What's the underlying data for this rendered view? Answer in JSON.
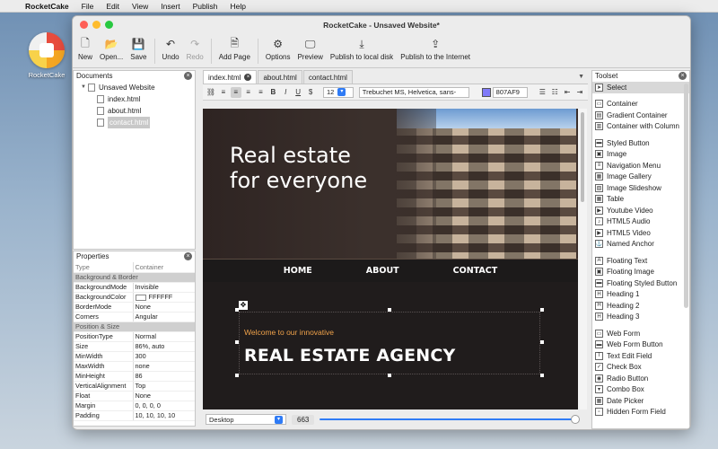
{
  "menubar": {
    "app_name": "RocketCake",
    "items": [
      "File",
      "Edit",
      "View",
      "Insert",
      "Publish",
      "Help"
    ]
  },
  "desktop": {
    "icon_label": "RocketCake"
  },
  "window": {
    "title": "RocketCake - Unsaved Website*"
  },
  "toolbar": {
    "new": "New",
    "open": "Open...",
    "save": "Save",
    "undo": "Undo",
    "redo": "Redo",
    "add_page": "Add Page",
    "options": "Options",
    "preview": "Preview",
    "publish_local": "Publish to local disk",
    "publish_internet": "Publish to the Internet"
  },
  "documents": {
    "title": "Documents",
    "root": "Unsaved Website",
    "pages": [
      "index.html",
      "about.html",
      "contact.html"
    ],
    "selected_page": "contact.html"
  },
  "properties": {
    "title": "Properties",
    "header": {
      "name": "Type",
      "value": "Container"
    },
    "rows": [
      {
        "section": "Background & Border"
      },
      {
        "name": "BackgroundMode",
        "value": "Invisible"
      },
      {
        "name": "BackgroundColor",
        "value": "FFFFFF",
        "swatch": true
      },
      {
        "name": "BorderMode",
        "value": "None"
      },
      {
        "name": "Corners",
        "value": "Angular"
      },
      {
        "section": "Position & Size"
      },
      {
        "name": "PositionType",
        "value": "Normal"
      },
      {
        "name": "Size",
        "value": "86%, auto"
      },
      {
        "name": "MinWidth",
        "value": "300"
      },
      {
        "name": "MaxWidth",
        "value": "none"
      },
      {
        "name": "MinHeight",
        "value": "86"
      },
      {
        "name": "VerticalAlignment",
        "value": "Top"
      },
      {
        "name": "Float",
        "value": "None"
      },
      {
        "name": "Margin",
        "value": "0, 0, 0, 0"
      },
      {
        "name": "Padding",
        "value": "10, 10, 10, 10"
      }
    ]
  },
  "editor": {
    "tabs": [
      "index.html",
      "about.html",
      "contact.html"
    ],
    "active_tab": "index.html",
    "font_size": "12",
    "font_family": "Trebuchet MS, Helvetica, sans-",
    "color_hex": "807AF9",
    "color": "#807af9"
  },
  "page": {
    "hero_line1": "Real estate",
    "hero_line2": "for everyone",
    "nav": [
      "HOME",
      "ABOUT",
      "CONTACT"
    ],
    "welcome": "Welcome to our innovative",
    "agency": "REAL ESTATE  AGENCY"
  },
  "bottom": {
    "device": "Desktop",
    "width": "663"
  },
  "toolset": {
    "title": "Toolset",
    "groups": [
      [
        {
          "label": "Select",
          "icon": "cursor-icon",
          "selected": true
        }
      ],
      [
        {
          "label": "Container",
          "icon": "container-icon"
        },
        {
          "label": "Gradient Container",
          "icon": "gradient-container-icon"
        },
        {
          "label": "Container with Column",
          "icon": "columns-icon"
        }
      ],
      [
        {
          "label": "Styled Button",
          "icon": "button-icon"
        },
        {
          "label": "Image",
          "icon": "image-icon"
        },
        {
          "label": "Navigation Menu",
          "icon": "menu-icon"
        },
        {
          "label": "Image Gallery",
          "icon": "gallery-icon"
        },
        {
          "label": "Image Slideshow",
          "icon": "slideshow-icon"
        },
        {
          "label": "Table",
          "icon": "table-icon"
        },
        {
          "label": "Youtube Video",
          "icon": "youtube-icon"
        },
        {
          "label": "HTML5 Audio",
          "icon": "audio-icon"
        },
        {
          "label": "HTML5 Video",
          "icon": "video-icon"
        },
        {
          "label": "Named Anchor",
          "icon": "anchor-icon"
        }
      ],
      [
        {
          "label": "Floating Text",
          "icon": "text-icon"
        },
        {
          "label": "Floating Image",
          "icon": "float-image-icon"
        },
        {
          "label": "Floating Styled Button",
          "icon": "float-button-icon"
        },
        {
          "label": "Heading 1",
          "icon": "heading1-icon"
        },
        {
          "label": "Heading 2",
          "icon": "heading2-icon"
        },
        {
          "label": "Heading 3",
          "icon": "heading3-icon"
        }
      ],
      [
        {
          "label": "Web Form",
          "icon": "form-icon"
        },
        {
          "label": "Web Form Button",
          "icon": "form-button-icon"
        },
        {
          "label": "Text Edit Field",
          "icon": "text-field-icon"
        },
        {
          "label": "Check Box",
          "icon": "checkbox-icon"
        },
        {
          "label": "Radio Button",
          "icon": "radio-icon"
        },
        {
          "label": "Combo Box",
          "icon": "combobox-icon"
        },
        {
          "label": "Date Picker",
          "icon": "date-picker-icon"
        },
        {
          "label": "Hidden Form Field",
          "icon": "hidden-field-icon"
        }
      ]
    ]
  }
}
